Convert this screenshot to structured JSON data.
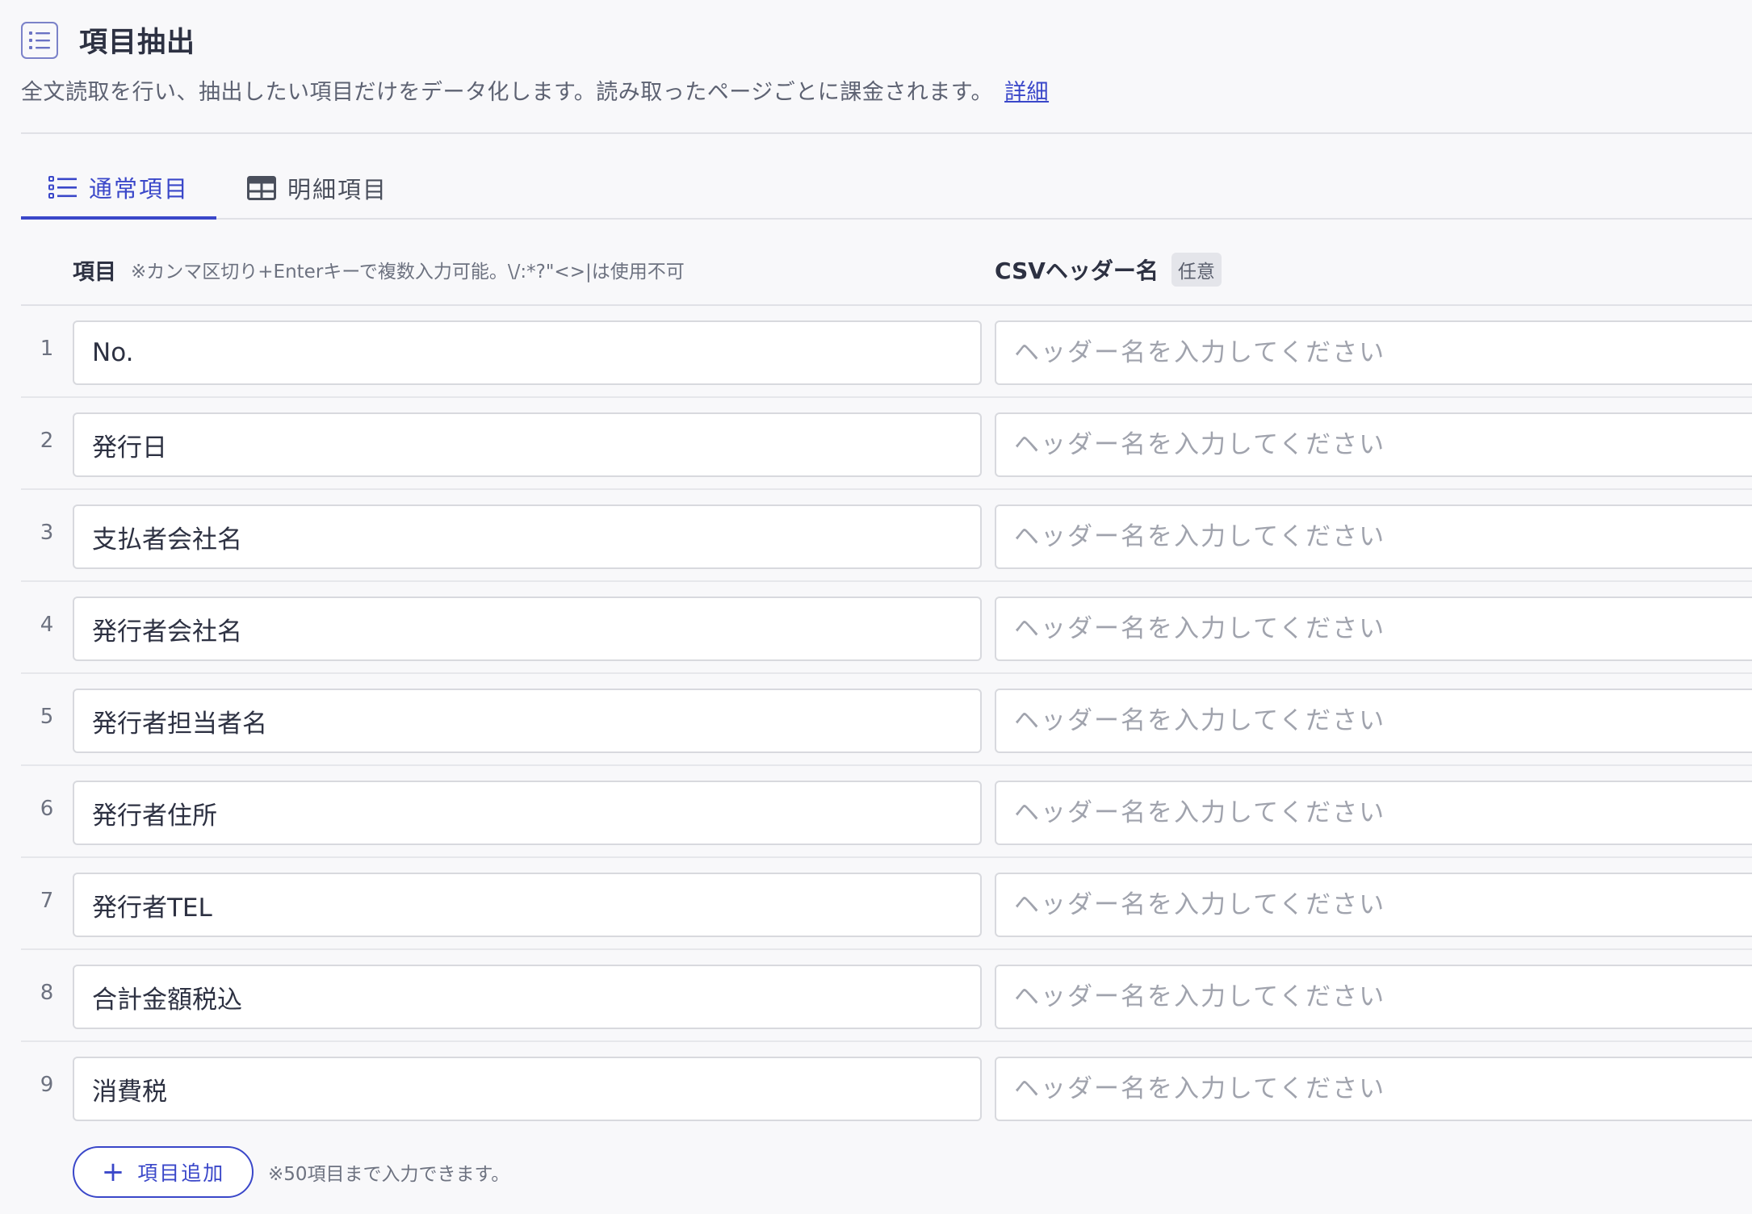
{
  "header": {
    "icon": "list-icon",
    "title": "項目抽出",
    "description": "全文読取を行い、抽出したい項目だけをデータ化します。読み取ったページごとに課金されます。",
    "detail_link": "詳細"
  },
  "tabs": [
    {
      "label": "通常項目",
      "icon": "list-icon",
      "active": true
    },
    {
      "label": "明細項目",
      "icon": "table-icon",
      "active": false
    }
  ],
  "columns": {
    "item_label": "項目",
    "item_hint": "※カンマ区切り+Enterキーで複数入力可能。\\/:*?\"<>|は使用不可",
    "csv_label": "CSVヘッダー名",
    "optional_badge": "任意"
  },
  "rows": [
    {
      "num": "1",
      "item": "No.",
      "csv_header": "",
      "csv_placeholder": "ヘッダー名を入力してください"
    },
    {
      "num": "2",
      "item": "発行日",
      "csv_header": "",
      "csv_placeholder": "ヘッダー名を入力してください"
    },
    {
      "num": "3",
      "item": "支払者会社名",
      "csv_header": "",
      "csv_placeholder": "ヘッダー名を入力してください"
    },
    {
      "num": "4",
      "item": "発行者会社名",
      "csv_header": "",
      "csv_placeholder": "ヘッダー名を入力してください"
    },
    {
      "num": "5",
      "item": "発行者担当者名",
      "csv_header": "",
      "csv_placeholder": "ヘッダー名を入力してください"
    },
    {
      "num": "6",
      "item": "発行者住所",
      "csv_header": "",
      "csv_placeholder": "ヘッダー名を入力してください"
    },
    {
      "num": "7",
      "item": "発行者TEL",
      "csv_header": "",
      "csv_placeholder": "ヘッダー名を入力してください"
    },
    {
      "num": "8",
      "item": "合計金額税込",
      "csv_header": "",
      "csv_placeholder": "ヘッダー名を入力してください"
    },
    {
      "num": "9",
      "item": "消費税",
      "csv_header": "",
      "csv_placeholder": "ヘッダー名を入力してください"
    }
  ],
  "footer": {
    "add_button_label": "項目追加",
    "add_button_icon": "plus-icon",
    "note": "※50項目まで入力できます。"
  },
  "colors": {
    "accent": "#3a47c9",
    "background": "#f8f8fa",
    "border": "#d8d9de"
  }
}
